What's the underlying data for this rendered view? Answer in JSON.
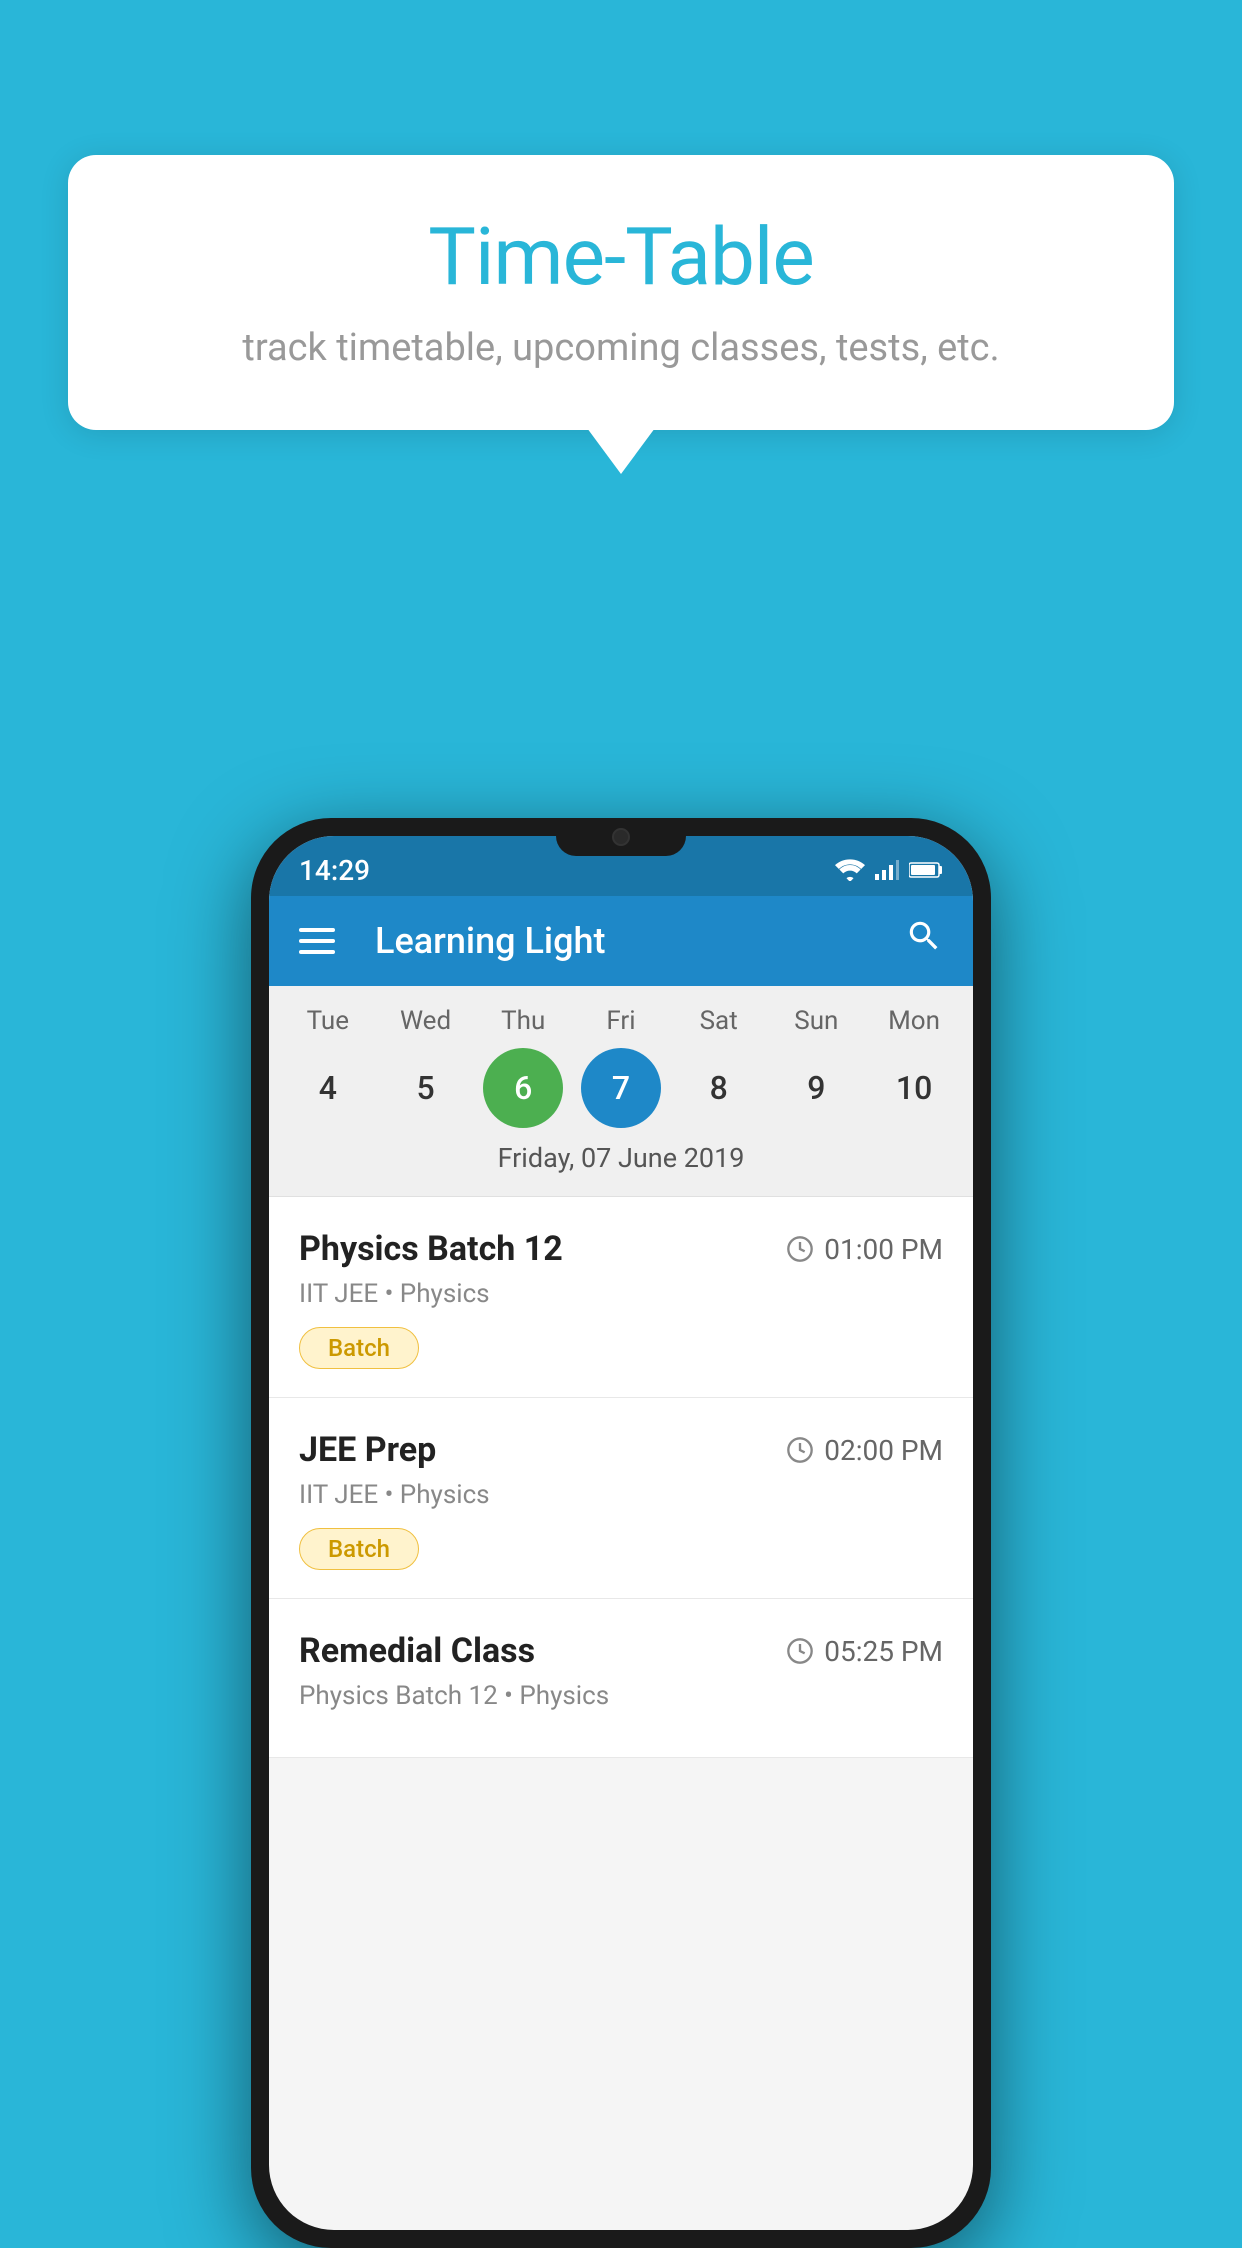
{
  "background_color": "#29B6D8",
  "tooltip": {
    "title": "Time-Table",
    "subtitle": "track timetable, upcoming classes, tests, etc."
  },
  "status_bar": {
    "time": "14:29"
  },
  "app_bar": {
    "title": "Learning Light",
    "search_icon_label": "search"
  },
  "calendar": {
    "days": [
      {
        "label": "Tue",
        "number": "4",
        "state": "normal"
      },
      {
        "label": "Wed",
        "number": "5",
        "state": "normal"
      },
      {
        "label": "Thu",
        "number": "6",
        "state": "today"
      },
      {
        "label": "Fri",
        "number": "7",
        "state": "selected"
      },
      {
        "label": "Sat",
        "number": "8",
        "state": "normal"
      },
      {
        "label": "Sun",
        "number": "9",
        "state": "normal"
      },
      {
        "label": "Mon",
        "number": "10",
        "state": "normal"
      }
    ],
    "selected_date_label": "Friday, 07 June 2019"
  },
  "classes": [
    {
      "name": "Physics Batch 12",
      "time": "01:00 PM",
      "meta": "IIT JEE • Physics",
      "badge": "Batch"
    },
    {
      "name": "JEE Prep",
      "time": "02:00 PM",
      "meta": "IIT JEE • Physics",
      "badge": "Batch"
    },
    {
      "name": "Remedial Class",
      "time": "05:25 PM",
      "meta": "Physics Batch 12 • Physics",
      "badge": ""
    }
  ]
}
